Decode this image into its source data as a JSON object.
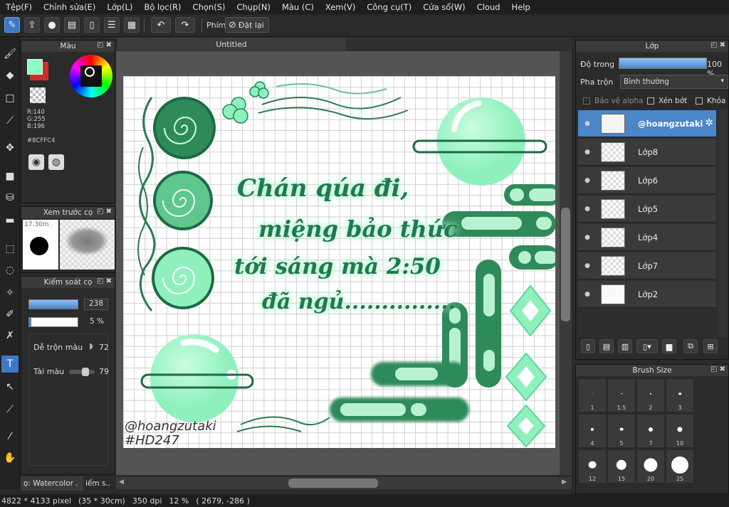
{
  "menu": [
    "Tệp(F)",
    "Chỉnh sửa(E)",
    "Lớp(L)",
    "Bộ lọc(R)",
    "Chọn(S)",
    "Chụp(N)",
    "Màu (C)",
    "Xem(V)",
    "Công cụ(T)",
    "Cửa sổ(W)",
    "Cloud",
    "Help"
  ],
  "toolbar": {
    "key_label": "Phím",
    "reset_label": "Đặt lại"
  },
  "color_panel": {
    "title": "Màu",
    "r": "R:140",
    "g": "G:255",
    "b": "B:196",
    "hex": "#8CFFC4",
    "primary_color": "#8CFFC4"
  },
  "brush_preview": {
    "title": "Xem trước cọ",
    "size": "17.30m"
  },
  "brush_control": {
    "title": "Kiểm soát cọ",
    "size_value": "238",
    "opacity_value": "5 %",
    "blend_label": "Dễ trộn màu",
    "blend_value": "72",
    "amount_label": "Tài màu",
    "amount_value": "79"
  },
  "bottom_tabs": {
    "tab1": "ọ: Watercolor .",
    "tab2": "iểm s.."
  },
  "document": {
    "tab_title": "Untitled"
  },
  "artwork": {
    "line1": "Chán qúa đi,",
    "line2": "miệng bảo thức",
    "line3": "tới sáng mà 2:50",
    "line4": "đã ngủ...............",
    "sign1": "@hoangzutaki",
    "sign2": "#HD247"
  },
  "layers_panel": {
    "title": "Lớp",
    "opacity_label": "Độ trong",
    "opacity_value": "100 %",
    "opacity_fraction": 1.0,
    "blend_label": "Pha trộn",
    "blend_value": "Bình thường",
    "protect_alpha": "Bảo vệ alpha",
    "clipping": "Xén bớt",
    "lock": "Khóa",
    "layers": [
      {
        "name": "@hoangzutaki",
        "selected": true
      },
      {
        "name": "Lớp8",
        "selected": false
      },
      {
        "name": "Lớp6",
        "selected": false
      },
      {
        "name": "Lớp5",
        "selected": false
      },
      {
        "name": "Lớp4",
        "selected": false
      },
      {
        "name": "Lớp7",
        "selected": false
      },
      {
        "name": "Lớp2",
        "selected": false
      }
    ]
  },
  "brush_size_panel": {
    "title": "Brush Size",
    "sizes": [
      "1",
      "1.5",
      "2",
      "3",
      "4",
      "5",
      "7",
      "10",
      "12",
      "15",
      "20",
      "25"
    ]
  },
  "status": {
    "pixels": "4822 * 4133 pixel",
    "cm": "(35 * 30cm)",
    "dpi": "350 dpi",
    "zoom": "12 %",
    "coords": "( 2679, -286 )"
  }
}
